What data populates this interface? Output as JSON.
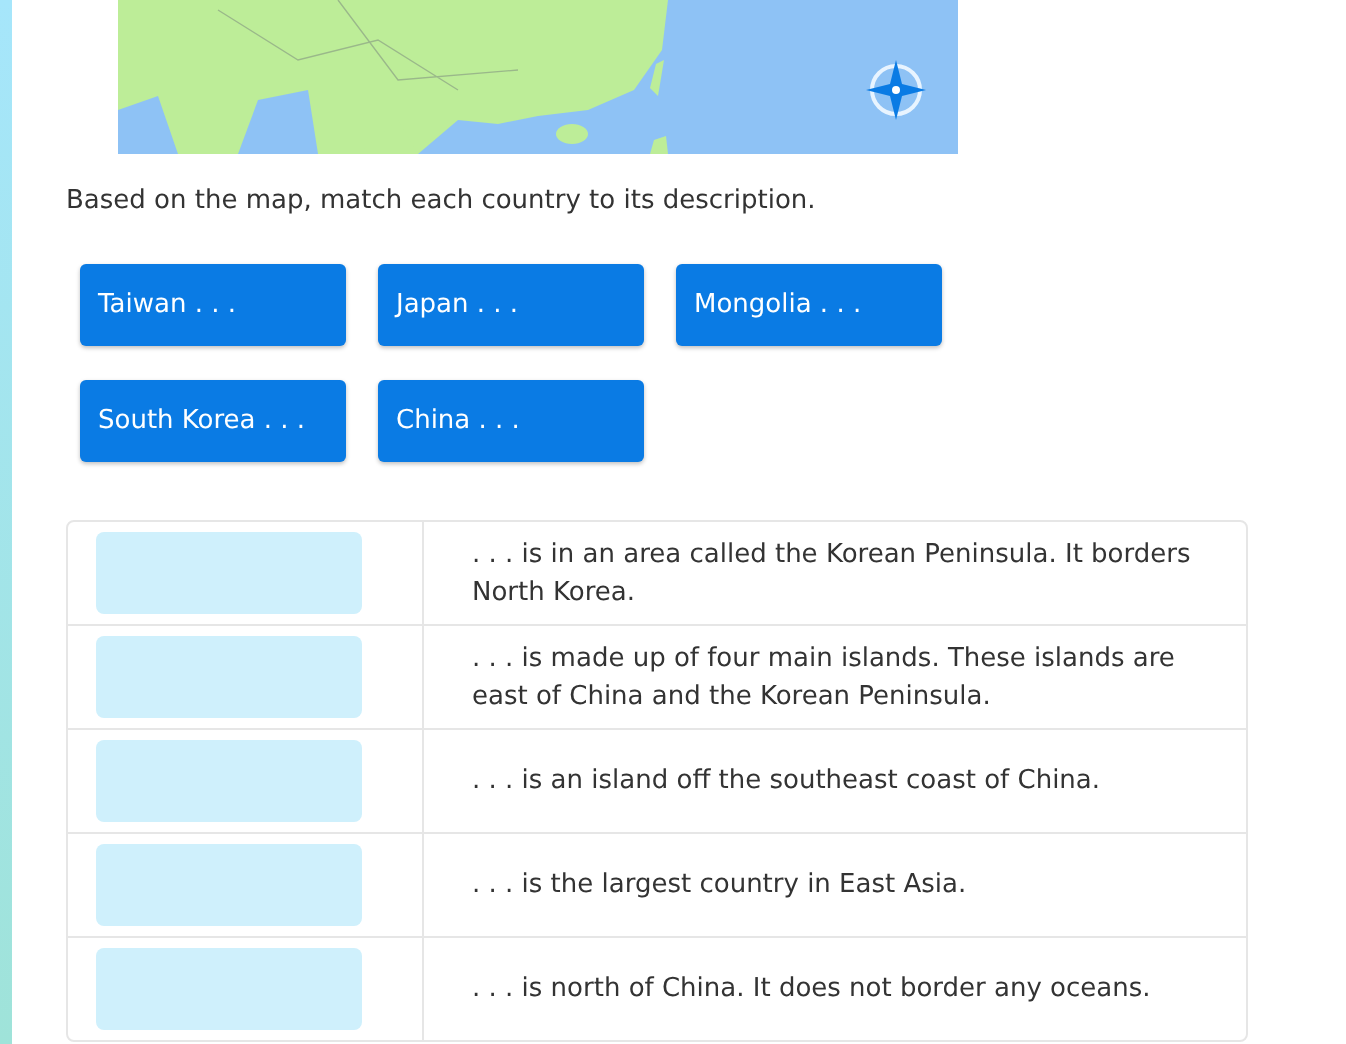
{
  "instruction": "Based on the map, match each country to its description.",
  "choices": [
    "Taiwan . . .",
    "Japan . . .",
    "Mongolia . . .",
    "South Korea . . .",
    "China . . ."
  ],
  "rows": [
    {
      "description": ". . . is in an area called the Korean Peninsula. It borders North Korea."
    },
    {
      "description": ". . . is made up of four main islands. These islands are east of China and the Korean Peninsula."
    },
    {
      "description": ". . . is an island off the southeast coast of China."
    },
    {
      "description": ". . . is the largest country in East Asia."
    },
    {
      "description": ". . . is north of China. It does not border any oceans."
    }
  ]
}
